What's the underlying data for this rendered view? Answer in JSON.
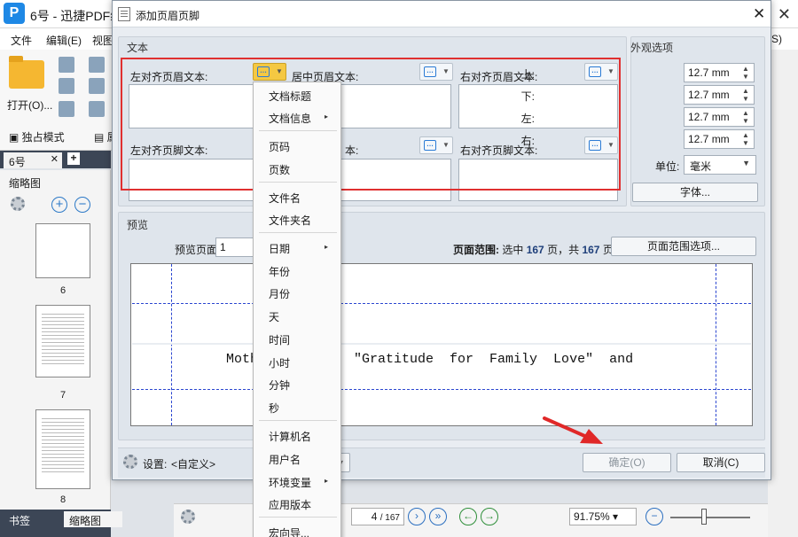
{
  "app": {
    "title": "6号 - 迅捷PDF编",
    "logo": "P",
    "menus": [
      "文件",
      "编辑(E)",
      "视图"
    ],
    "menu_right": "S)",
    "open_label": "打开(O)...",
    "solo_mode": "独占模式",
    "prop_label": "属性",
    "doc_tab": "6号",
    "panel_title": "缩略图",
    "thumbs": [
      "6",
      "7",
      "8"
    ],
    "bottom_tabs": [
      "书签",
      "缩略图"
    ],
    "page_current": "4",
    "page_total": "/ 167",
    "zoom": "91.75%"
  },
  "dialog": {
    "title": "添加页眉页脚",
    "text_group": "文本",
    "fields": {
      "header_left": "左对齐页眉文本:",
      "header_center": "居中页眉文本:",
      "header_right": "右对齐页眉文本:",
      "footer_left": "左对齐页脚文本:",
      "footer_center": "本:",
      "footer_right": "右对齐页脚文本:"
    },
    "appearance_group": "外观选项",
    "margins": [
      {
        "label": "上:",
        "value": "12.7 mm"
      },
      {
        "label": "下:",
        "value": "12.7 mm"
      },
      {
        "label": "左:",
        "value": "12.7 mm"
      },
      {
        "label": "右:",
        "value": "12.7 mm"
      }
    ],
    "unit_label": "单位:",
    "unit_value": "毫米",
    "font_button": "字体...",
    "preview_group": "预览",
    "preview_page_label": "预览页面",
    "preview_page_value": "1",
    "page_range_prefix": "页面范围:",
    "page_range_text": "选中",
    "page_range_selected": "167",
    "page_range_mid": "页，共",
    "page_range_total": "167",
    "page_range_suffix": "页",
    "page_range_button": "页面范围选项...",
    "preview_text": "Moth        \",  \"Gratitude  for  Family  Love\"  and",
    "settings_label": "设置:",
    "settings_value": "<自定义>",
    "ok_button": "确定(O)",
    "cancel_button": "取消(C)",
    "colors": {
      "highlight_frame": "#e03030",
      "guide_lines": "#2b46d0",
      "active_macro": "#f5c842"
    }
  },
  "context_menu": {
    "items": [
      {
        "label": "文档标题",
        "submenu": false
      },
      {
        "label": "文档信息",
        "submenu": true
      },
      {
        "label": "页码",
        "submenu": false
      },
      {
        "label": "页数",
        "submenu": false
      },
      {
        "label": "文件名",
        "submenu": false
      },
      {
        "label": "文件夹名",
        "submenu": false
      },
      {
        "label": "日期",
        "submenu": true
      },
      {
        "label": "年份",
        "submenu": false
      },
      {
        "label": "月份",
        "submenu": false
      },
      {
        "label": "天",
        "submenu": false
      },
      {
        "label": "时间",
        "submenu": false
      },
      {
        "label": "小时",
        "submenu": false
      },
      {
        "label": "分钟",
        "submenu": false
      },
      {
        "label": "秒",
        "submenu": false
      },
      {
        "label": "计算机名",
        "submenu": false
      },
      {
        "label": "用户名",
        "submenu": false
      },
      {
        "label": "环境变量",
        "submenu": true
      },
      {
        "label": "应用版本",
        "submenu": false
      },
      {
        "label": "宏向导...",
        "submenu": false
      }
    ],
    "submenu_glyph": "▸"
  }
}
